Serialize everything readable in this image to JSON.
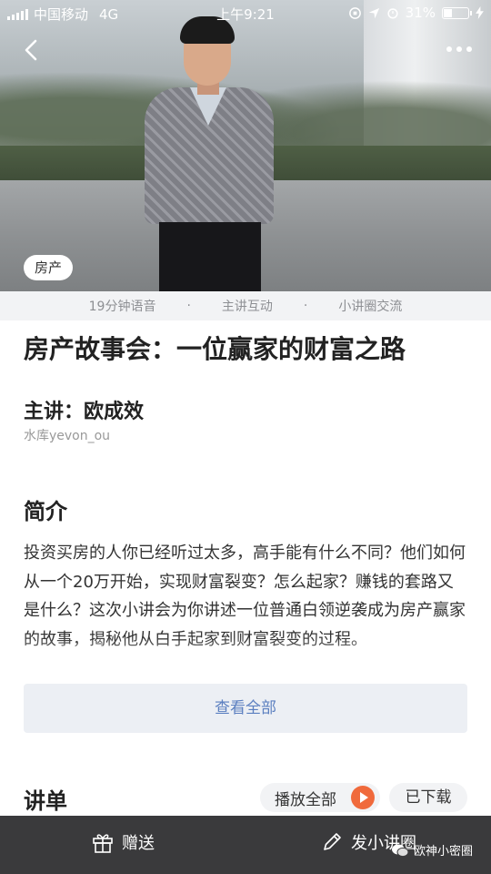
{
  "status_bar": {
    "carrier": "中国移动",
    "network": "4G",
    "time": "上午9:21",
    "battery_percent": "31%",
    "battery_level": 0.31
  },
  "hero": {
    "category_tag": "房产"
  },
  "features": [
    "19分钟语音",
    "·",
    "主讲互动",
    "·",
    "小讲圈交流"
  ],
  "course": {
    "title": "房产故事会：一位赢家的财富之路",
    "lecturer": "主讲：欧成效",
    "handle": "水库yevon_ou"
  },
  "intro": {
    "heading": "简介",
    "text": "投资买房的人你已经听过太多，高手能有什么不同？他们如何从一个20万开始，实现财富裂变？怎么起家？赚钱的套路又是什么？这次小讲会为你讲述一位普通白领逆袭成为房产赢家的故事，揭秘他从白手起家到财富裂变的过程。",
    "view_all": "查看全部"
  },
  "playlist": {
    "heading": "讲单",
    "play_all": "播放全部",
    "downloaded": "已下载"
  },
  "bottom_bar": {
    "gift": "赠送",
    "post": "发小讲圈",
    "watermark": "欧神小密圈"
  },
  "icons": {
    "back": "back-icon",
    "more": "more-icon",
    "gift": "gift-icon",
    "edit": "pencil-icon",
    "play": "play-icon"
  },
  "colors": {
    "accent_play": "#f06a3c",
    "link": "#5b7fc0",
    "bottom_bar": "#3a3a3c"
  }
}
